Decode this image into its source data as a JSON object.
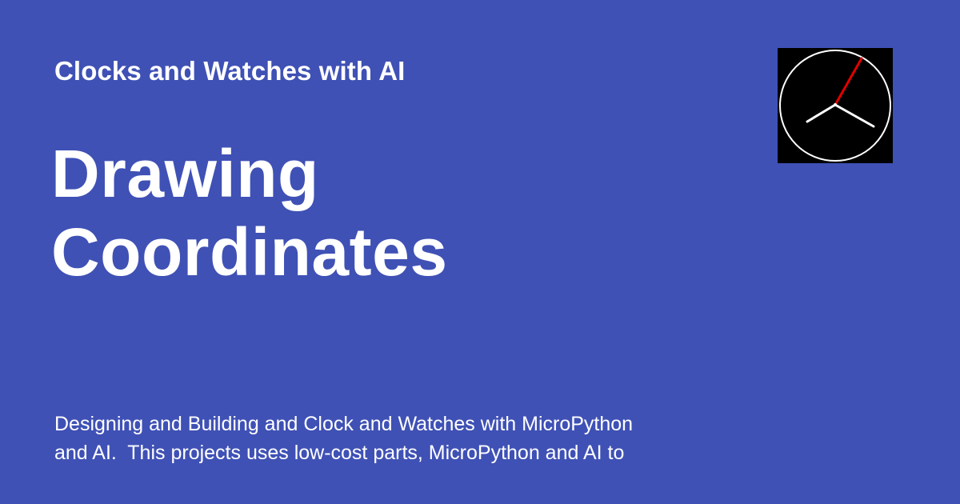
{
  "site": {
    "name": "Clocks and Watches with AI"
  },
  "page": {
    "title_line_1": "Drawing",
    "title_line_2": "Coordinates",
    "description": "Designing and Building and Clock and Watches with MicroPython\nand AI.  This projects uses low-cost parts, MicroPython and AI to"
  },
  "logo": {
    "icon": "analog-clock-icon",
    "background_color": "#000000",
    "face_color": "#ffffff",
    "hand_color": "#ffffff",
    "second_hand_color": "#e00000"
  },
  "colors": {
    "background": "#3f51b5",
    "text": "#ffffff"
  }
}
